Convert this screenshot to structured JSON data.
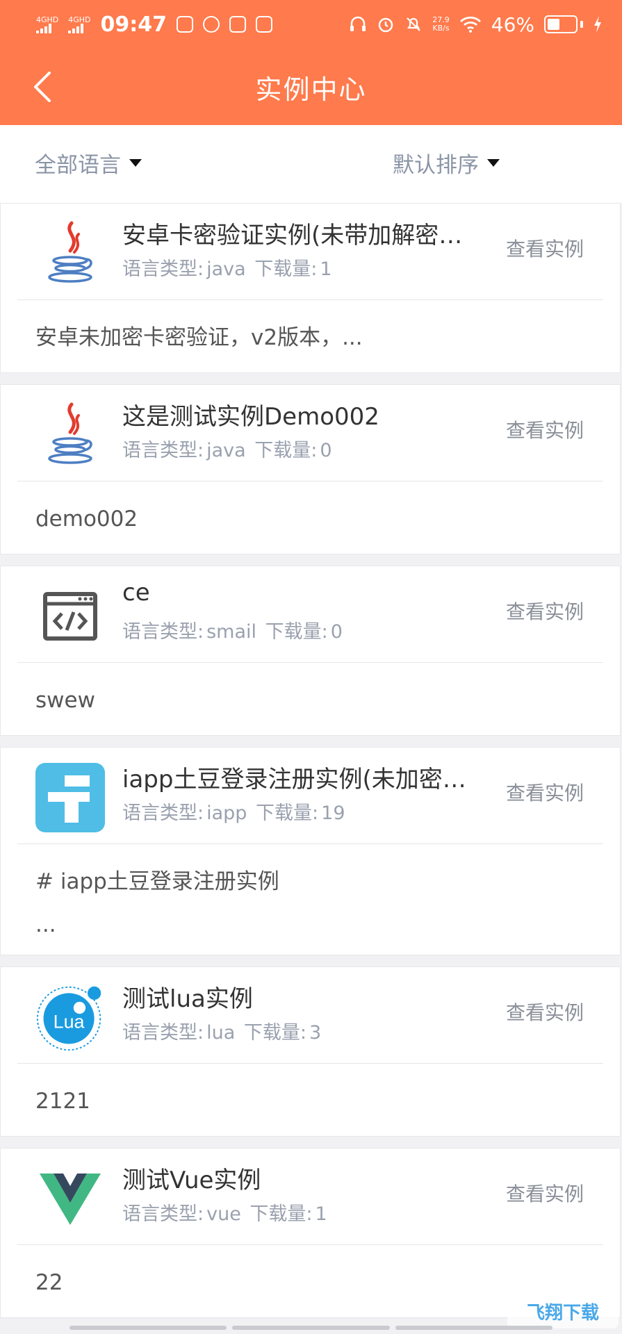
{
  "status_bar": {
    "network1": "4GHD",
    "network2": "4GHD",
    "time": "09:47",
    "net_speed_value": "27.9",
    "net_speed_unit": "KB/s",
    "battery_percent": "46%",
    "battery_level": 0.46
  },
  "nav": {
    "title": "实例中心"
  },
  "filters": {
    "language": "全部语言",
    "sort": "默认排序"
  },
  "labels": {
    "lang_prefix": "语言类型:",
    "download_prefix": "下载量:",
    "view_button": "查看实例"
  },
  "cards": [
    {
      "icon": "java-icon",
      "title": "安卓卡密验证实例(未带加解密…",
      "language": "java",
      "downloads": "1",
      "description": "安卓未加密卡密验证，v2版本，..."
    },
    {
      "icon": "java-icon",
      "title": "这是测试实例Demo002",
      "language": "java",
      "downloads": "0",
      "description": "demo002"
    },
    {
      "icon": "code-window-icon",
      "title": "ce",
      "language": "smail",
      "downloads": "0",
      "description": "swew"
    },
    {
      "icon": "iapp-icon",
      "title": "iapp土豆登录注册实例(未加密…",
      "language": "iapp",
      "downloads": "19",
      "description": "# iapp土豆登录注册实例\n..."
    },
    {
      "icon": "lua-icon",
      "icon_text": "Lua",
      "title": "测试lua实例",
      "language": "lua",
      "downloads": "3",
      "description": "2121"
    },
    {
      "icon": "vue-icon",
      "title": "测试Vue实例",
      "language": "vue",
      "downloads": "1",
      "description": "22"
    }
  ],
  "watermark": "飞翔下载",
  "colors": {
    "header": "#ff7a4c",
    "filter_text": "#8a94a6",
    "meta_text": "#9aa1ae",
    "iapp_blue": "#4fbde6",
    "lua_blue": "#1a9be0",
    "vue_green": "#41b883",
    "vue_dark": "#35495e",
    "java_red": "#e23b2d",
    "java_blue": "#4d7ec2"
  }
}
